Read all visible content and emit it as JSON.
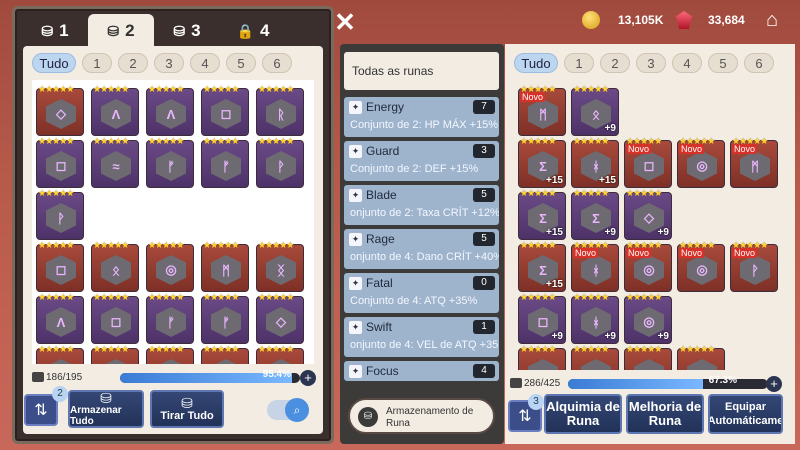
{
  "storage": {
    "tabs": [
      {
        "label": "1",
        "icon": "rune-box-icon"
      },
      {
        "label": "2",
        "icon": "rune-box-icon"
      },
      {
        "label": "3",
        "icon": "rune-box-icon"
      },
      {
        "label": "4",
        "icon": "lock-icon"
      }
    ],
    "active_tab": 1,
    "filters": [
      "Tudo",
      "1",
      "2",
      "3",
      "4",
      "5",
      "6"
    ],
    "capacity_text": "186/195",
    "capacity_pct_label": "95.4%",
    "capacity_fraction": 0.954,
    "sort_badge": "2",
    "store_all_label": "Armazenar Tudo",
    "take_all_label": "Tirar Tudo"
  },
  "rune_sets": {
    "title": "Todas as runas",
    "items": [
      {
        "name": "Energy",
        "count": "7",
        "desc": "Conjunto de 2: HP MÁX +15%",
        "icon": "energy-icon"
      },
      {
        "name": "Guard",
        "count": "3",
        "desc": "Conjunto de 2: DEF +15%",
        "icon": "guard-icon"
      },
      {
        "name": "Blade",
        "count": "5",
        "desc": "onjunto de 2: Taxa CRÍT +12%",
        "icon": "blade-icon"
      },
      {
        "name": "Rage",
        "count": "5",
        "desc": "onjunto de 4: Dano CRÍT +40%",
        "icon": "rage-icon"
      },
      {
        "name": "Fatal",
        "count": "0",
        "desc": "Conjunto de 4: ATQ +35%",
        "icon": "fatal-icon"
      },
      {
        "name": "Swift",
        "count": "1",
        "desc": "onjunto de 4: VEL de ATQ +35",
        "icon": "swift-icon"
      },
      {
        "name": "Focus",
        "count": "4",
        "desc": "",
        "icon": "focus-icon"
      }
    ],
    "storage_button_label": "Armazenamento de Runa"
  },
  "header": {
    "coins": "13,105K",
    "gems": "33,684"
  },
  "inventory": {
    "filters": [
      "Tudo",
      "1",
      "2",
      "3",
      "4",
      "5",
      "6"
    ],
    "capacity_text": "286/425",
    "capacity_pct_label": "67.3%",
    "capacity_fraction": 0.673,
    "sort_badge": "3",
    "alchemy_label": "Alquimia de Runa",
    "upgrade_label": "Melhoria de Runa",
    "auto_equip_label": "Equipar Automáticame",
    "new_label": "Novo"
  },
  "rune_stars": "★★★★★",
  "left_runes": [
    {
      "c": "red",
      "g": "◇"
    },
    {
      "c": "purple",
      "g": "Λ"
    },
    {
      "c": "purple",
      "g": "Λ"
    },
    {
      "c": "purple",
      "g": "◻"
    },
    {
      "c": "purple",
      "g": "ᚱ"
    },
    {
      "c": "purple",
      "g": "◻"
    },
    {
      "c": "purple",
      "g": "≈"
    },
    {
      "c": "purple",
      "g": "ᚠ"
    },
    {
      "c": "purple",
      "g": "ᚠ"
    },
    {
      "c": "purple",
      "g": "ᚹ"
    },
    {
      "c": "purple",
      "g": "ᚹ"
    },
    {
      "c": "red",
      "g": "◻"
    },
    {
      "c": "red",
      "g": "ᛟ"
    },
    {
      "c": "red",
      "g": "◎"
    },
    {
      "c": "red",
      "g": "ᛗ"
    },
    {
      "c": "red",
      "g": "ᛝ"
    },
    {
      "c": "purple",
      "g": "Λ"
    },
    {
      "c": "purple",
      "g": "◻"
    },
    {
      "c": "purple",
      "g": "ᚠ"
    },
    {
      "c": "purple",
      "g": "ᚠ"
    },
    {
      "c": "purple",
      "g": "◇"
    }
  ],
  "right_runes": [
    [
      {
        "c": "red",
        "g": "ᛗ",
        "novo": true,
        "lvl": ""
      },
      {
        "c": "purple",
        "g": "ᛟ",
        "novo": false,
        "lvl": "+9"
      }
    ],
    [
      {
        "c": "red",
        "g": "Σ",
        "novo": false,
        "lvl": "+15"
      },
      {
        "c": "red",
        "g": "ᚼ",
        "novo": false,
        "lvl": "+15"
      },
      {
        "c": "red",
        "g": "◻",
        "novo": true,
        "lvl": ""
      },
      {
        "c": "red",
        "g": "◎",
        "novo": true,
        "lvl": ""
      },
      {
        "c": "red",
        "g": "ᛗ",
        "novo": true,
        "lvl": ""
      }
    ],
    [
      {
        "c": "purple",
        "g": "Σ",
        "novo": false,
        "lvl": "+15"
      },
      {
        "c": "purple",
        "g": "Σ",
        "novo": false,
        "lvl": "+9"
      },
      {
        "c": "purple",
        "g": "◇",
        "novo": false,
        "lvl": "+9"
      }
    ],
    [
      {
        "c": "red",
        "g": "Σ",
        "novo": false,
        "lvl": "+15"
      },
      {
        "c": "red",
        "g": "ᚼ",
        "novo": true,
        "lvl": ""
      },
      {
        "c": "red",
        "g": "◎",
        "novo": true,
        "lvl": ""
      },
      {
        "c": "red",
        "g": "◎",
        "novo": true,
        "lvl": ""
      },
      {
        "c": "red",
        "g": "ᚹ",
        "novo": true,
        "lvl": ""
      }
    ],
    [
      {
        "c": "purple",
        "g": "◻",
        "novo": false,
        "lvl": "+9"
      },
      {
        "c": "purple",
        "g": "ᚼ",
        "novo": false,
        "lvl": "+9"
      },
      {
        "c": "purple",
        "g": "◎",
        "novo": false,
        "lvl": "+9"
      }
    ],
    [
      {
        "c": "red",
        "g": "",
        "novo": false,
        "lvl": ""
      },
      {
        "c": "red",
        "g": "",
        "novo": false,
        "lvl": ""
      },
      {
        "c": "red",
        "g": "",
        "novo": false,
        "lvl": ""
      },
      {
        "c": "red",
        "g": "",
        "novo": false,
        "lvl": ""
      }
    ]
  ],
  "colors": {
    "accent": "#3a7bd5",
    "button": "#223258",
    "new_badge": "#d6322a"
  }
}
